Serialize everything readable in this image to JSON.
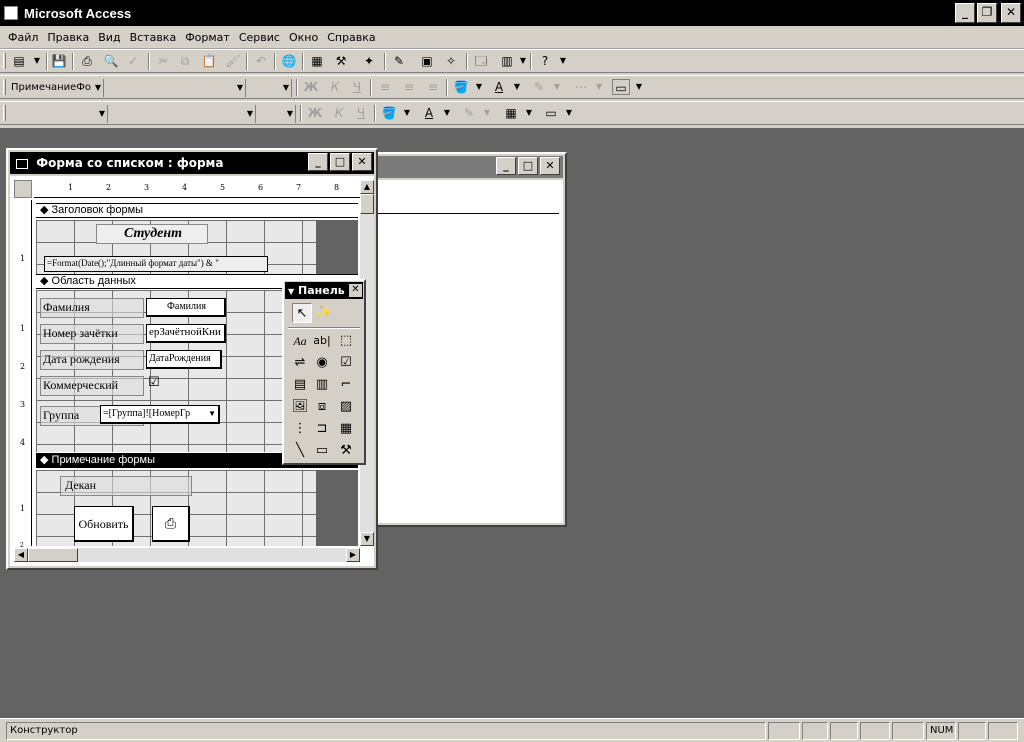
{
  "app": {
    "title": "Microsoft Access"
  },
  "menu": [
    "Файл",
    "Правка",
    "Вид",
    "Вставка",
    "Формат",
    "Сервис",
    "Окно",
    "Справка"
  ],
  "format_toolbar": {
    "object_combo": "ПримечаниеФо"
  },
  "form_window": {
    "title": "Форма со списком : форма",
    "ruler_numbers": [
      "1",
      "2",
      "3",
      "4",
      "5",
      "6",
      "7",
      "8"
    ],
    "left_ruler_numbers": [
      "1",
      "1",
      "2",
      "3",
      "4",
      "1",
      "2"
    ],
    "header_section": "Заголовок формы",
    "title_label": "Студент",
    "date_expr": "=Format(Date();\"Длинный формат даты\") & \"",
    "detail_section": "Область данных",
    "fields": [
      {
        "label": "Фамилия",
        "control": "Фамилия"
      },
      {
        "label": "Номер зачётки",
        "control": "ерЗачётнойКни"
      },
      {
        "label": "Дата рождения",
        "control": "ДатаРождения"
      },
      {
        "label": "Коммерческий",
        "control": "☑"
      },
      {
        "label": "Группа",
        "control": "=[Группа]![НомерГр"
      }
    ],
    "footer_section": "Примечание формы",
    "dean_label": "Декан",
    "refresh_button": "Обновить"
  },
  "toolbox": {
    "title": "Панель",
    "text_icon": "Aa",
    "textbox_icon": "ab|"
  },
  "status": {
    "mode": "Конструктор",
    "num": "NUM"
  }
}
